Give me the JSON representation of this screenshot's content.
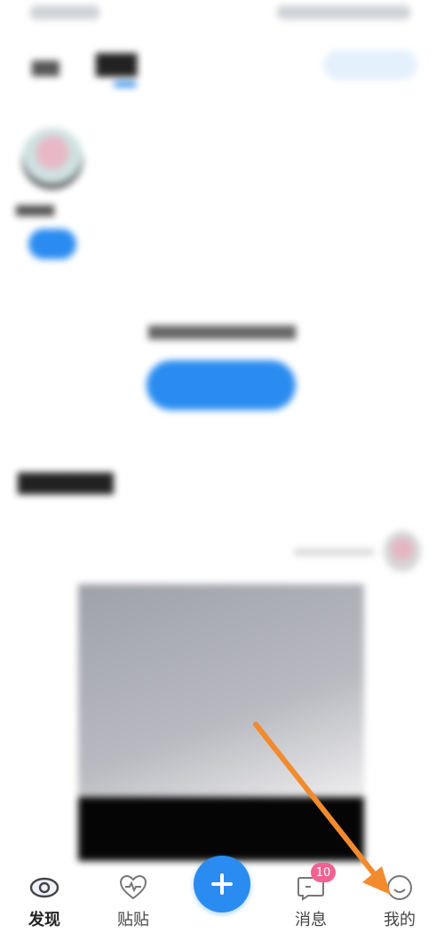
{
  "bottom_nav": {
    "items": [
      {
        "label": "发现",
        "icon": "eye-icon",
        "active": true
      },
      {
        "label": "贴贴",
        "icon": "heart-pulse-icon",
        "active": false
      },
      {
        "label": "",
        "icon": "plus-icon",
        "active": false
      },
      {
        "label": "消息",
        "icon": "message-icon",
        "active": false
      },
      {
        "label": "我的",
        "icon": "smile-icon",
        "active": false
      }
    ],
    "message_badge": "10"
  },
  "colors": {
    "accent": "#2a8cf0",
    "badge": "#f06292",
    "annotation_arrow": "#f28a2e"
  }
}
